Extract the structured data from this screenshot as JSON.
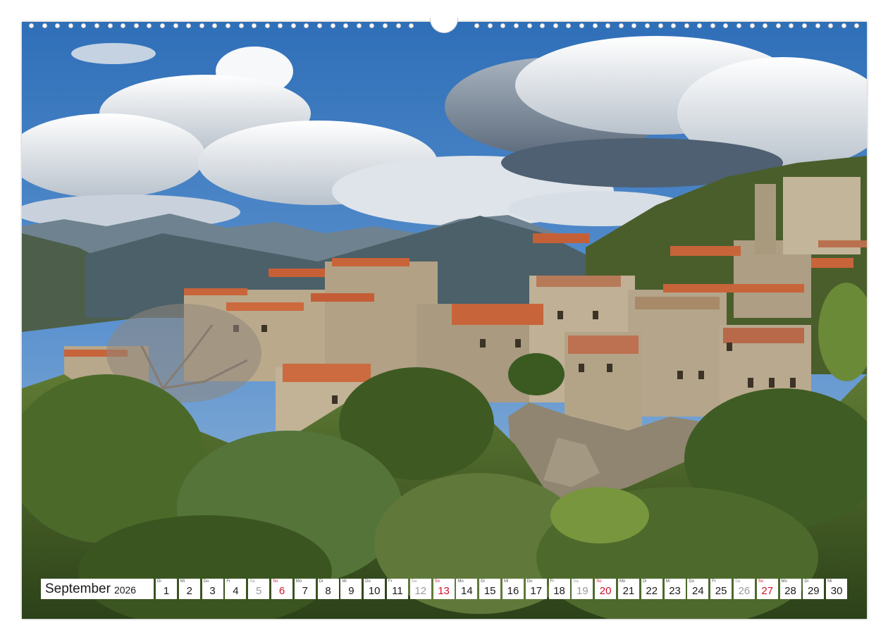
{
  "calendar": {
    "month": "September",
    "year": "2026",
    "days": [
      {
        "wd": "Di",
        "n": "1",
        "t": "w"
      },
      {
        "wd": "Mi",
        "n": "2",
        "t": "w"
      },
      {
        "wd": "Do",
        "n": "3",
        "t": "w"
      },
      {
        "wd": "Fr",
        "n": "4",
        "t": "w"
      },
      {
        "wd": "Sa",
        "n": "5",
        "t": "sat"
      },
      {
        "wd": "So",
        "n": "6",
        "t": "sun"
      },
      {
        "wd": "Mo",
        "n": "7",
        "t": "w"
      },
      {
        "wd": "Di",
        "n": "8",
        "t": "w"
      },
      {
        "wd": "Mi",
        "n": "9",
        "t": "w"
      },
      {
        "wd": "Do",
        "n": "10",
        "t": "w"
      },
      {
        "wd": "Fr",
        "n": "11",
        "t": "w"
      },
      {
        "wd": "Sa",
        "n": "12",
        "t": "sat"
      },
      {
        "wd": "So",
        "n": "13",
        "t": "sun"
      },
      {
        "wd": "Mo",
        "n": "14",
        "t": "w"
      },
      {
        "wd": "Di",
        "n": "15",
        "t": "w"
      },
      {
        "wd": "Mi",
        "n": "16",
        "t": "w"
      },
      {
        "wd": "Do",
        "n": "17",
        "t": "w"
      },
      {
        "wd": "Fr",
        "n": "18",
        "t": "w"
      },
      {
        "wd": "Sa",
        "n": "19",
        "t": "sat"
      },
      {
        "wd": "So",
        "n": "20",
        "t": "sun"
      },
      {
        "wd": "Mo",
        "n": "21",
        "t": "w"
      },
      {
        "wd": "Di",
        "n": "22",
        "t": "w"
      },
      {
        "wd": "Mi",
        "n": "23",
        "t": "w"
      },
      {
        "wd": "Do",
        "n": "24",
        "t": "w"
      },
      {
        "wd": "Fr",
        "n": "25",
        "t": "w"
      },
      {
        "wd": "Sa",
        "n": "26",
        "t": "sat"
      },
      {
        "wd": "So",
        "n": "27",
        "t": "sun"
      },
      {
        "wd": "Mo",
        "n": "28",
        "t": "w"
      },
      {
        "wd": "Di",
        "n": "29",
        "t": "w"
      },
      {
        "wd": "Mi",
        "n": "30",
        "t": "w"
      }
    ]
  },
  "photo": {
    "subject": "hilltop-stone-village",
    "colors": {
      "sky": "#3f7fc4",
      "cloud": "#eef1f4",
      "mountain": "#5a6e7a",
      "stone": "#b8a88e",
      "roof": "#c8643a",
      "tree": "#4f6b2c",
      "treeDark": "#2f4a1e"
    }
  },
  "colors": {
    "sunday": "#d0122a",
    "saturday": "#9a9a9a",
    "text": "#1a1a1a"
  }
}
